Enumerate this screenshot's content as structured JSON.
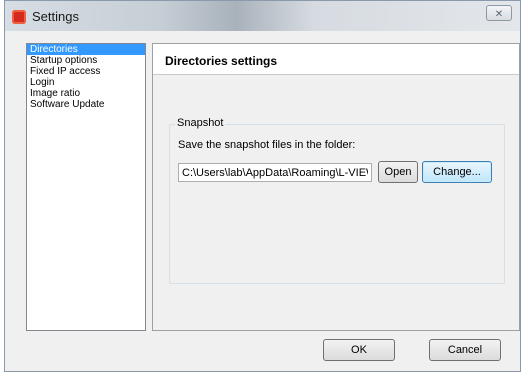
{
  "window": {
    "title": "Settings",
    "close_glyph": "✕"
  },
  "sidebar": {
    "items": [
      {
        "label": "Directories"
      },
      {
        "label": "Startup options"
      },
      {
        "label": "Fixed IP access"
      },
      {
        "label": "Login"
      },
      {
        "label": "Image ratio"
      },
      {
        "label": "Software Update"
      }
    ],
    "selected_index": 0
  },
  "panel": {
    "title": "Directories settings",
    "snapshot": {
      "legend": "Snapshot",
      "description": "Save the snapshot files in the folder:",
      "path_value": "C:\\Users\\lab\\AppData\\Roaming\\L-VIEW",
      "open_label": "Open",
      "change_label": "Change..."
    }
  },
  "footer": {
    "ok_label": "OK",
    "cancel_label": "Cancel"
  },
  "colors": {
    "selection": "#3399ff",
    "dialog_bg": "#f0f0f0",
    "app_icon": "#d42a1e"
  },
  "icons": {
    "app": "settings-app-icon",
    "close": "close-icon"
  }
}
